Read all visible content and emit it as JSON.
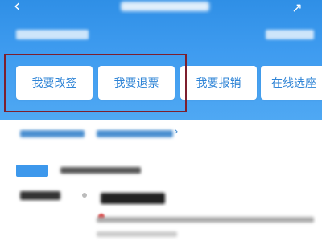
{
  "header": {
    "back_icon": "back-chevron-icon",
    "share_icon": "share-icon"
  },
  "actions": {
    "change": "我要改签",
    "refund": "我要退票",
    "reimburse": "我要报销",
    "online_seat": "在线选座"
  },
  "colors": {
    "header_blue": "#3f9cf0",
    "button_text": "#2f84d6",
    "highlight_box": "#7d1f2e"
  }
}
